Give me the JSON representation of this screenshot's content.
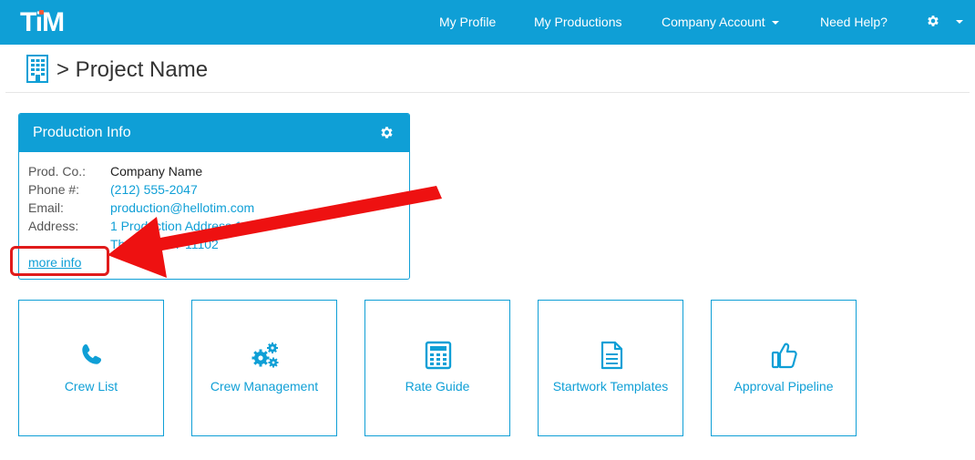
{
  "app": {
    "logo_text": "TiM",
    "accent_color": "#0f9fd6",
    "logo_dot_color": "#f15a3a"
  },
  "nav": {
    "items": [
      {
        "label": "My Profile"
      },
      {
        "label": "My Productions"
      },
      {
        "label": "Company Account",
        "has_caret": true
      },
      {
        "label": "Need Help?"
      }
    ],
    "settings_icon": "gear-icon"
  },
  "breadcrumb": {
    "icon": "building-icon",
    "text": "> Project Name"
  },
  "production_info": {
    "title": "Production Info",
    "settings_icon": "gear-icon",
    "rows": [
      {
        "label": "Prod. Co.:",
        "value": "Company Name"
      },
      {
        "label": "Phone #:",
        "value": "(212) 555-2047"
      },
      {
        "label": "Email:",
        "value": "production@hellotim.com"
      },
      {
        "label": "Address:",
        "value": "1 Production Address 1A"
      },
      {
        "label": "",
        "value": "The City, NY 11102"
      }
    ],
    "more_info_label": "more info"
  },
  "tiles": [
    {
      "label": "Crew List",
      "icon": "phone-icon"
    },
    {
      "label": "Crew Management",
      "icon": "gears-icon"
    },
    {
      "label": "Rate Guide",
      "icon": "calculator-icon"
    },
    {
      "label": "Startwork Templates",
      "icon": "document-icon"
    },
    {
      "label": "Approval Pipeline",
      "icon": "thumbs-up-icon"
    }
  ],
  "annotation": {
    "color": "#e01b1b",
    "target": "more-info-link"
  }
}
